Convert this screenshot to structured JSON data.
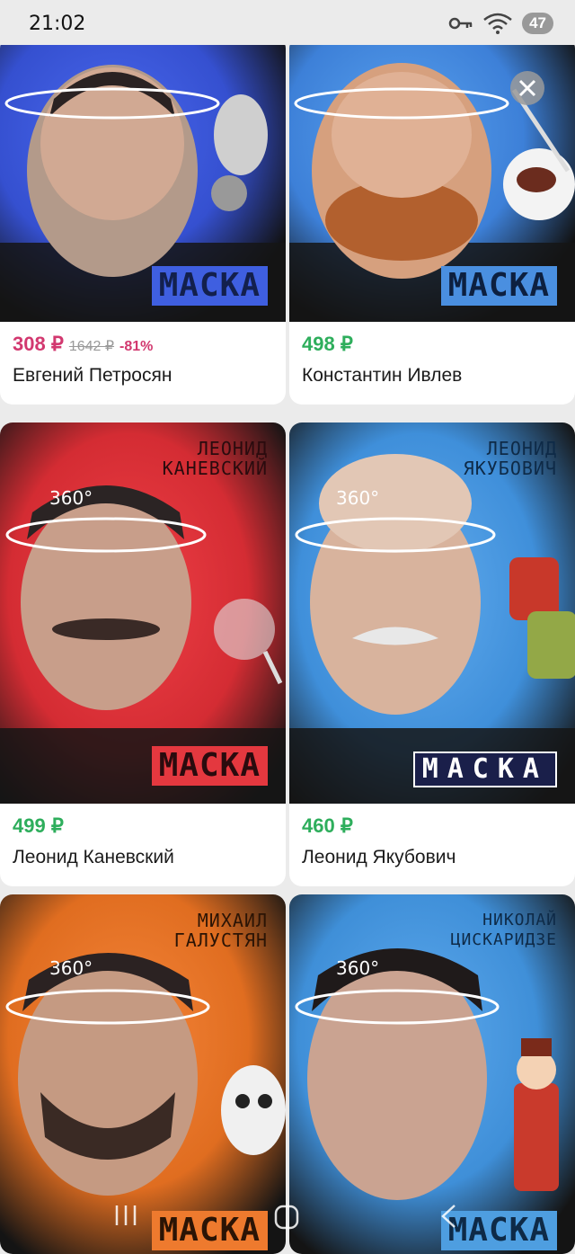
{
  "status_bar": {
    "time": "21:02",
    "battery": "47"
  },
  "products": [
    {
      "title": "Евгений Петросян",
      "price": "308 ₽",
      "old_price": "1642 ₽",
      "discount": "-81%",
      "brand": "МАСКА",
      "name_tag": "",
      "degrees": "",
      "bg": "#3f5fe0"
    },
    {
      "title": "Константин Ивлев",
      "price": "498 ₽",
      "old_price": "",
      "discount": "",
      "brand": "МАСКА",
      "name_tag": "",
      "degrees": "",
      "bg": "#4a8fe0"
    },
    {
      "title": "Леонид Каневский",
      "price": "499 ₽",
      "old_price": "",
      "discount": "",
      "brand": "МАСКА",
      "name_tag": "ЛЕОНИД\nКАНЕВСКИЙ",
      "degrees": "360°",
      "bg": "#e4383f"
    },
    {
      "title": "Леонид Якубович",
      "price": "460 ₽",
      "old_price": "",
      "discount": "",
      "brand": "МАСКА",
      "name_tag": "ЛЕОНИД\nЯКУБОВИЧ",
      "degrees": "360°",
      "bg": "#4d9fe6"
    },
    {
      "title": "",
      "price": "",
      "old_price": "",
      "discount": "",
      "brand": "МАСКА",
      "name_tag": "МИХАИЛ\nГАЛУСТЯН",
      "degrees": "360°",
      "bg": "#ee7a2e"
    },
    {
      "title": "",
      "price": "",
      "old_price": "",
      "discount": "",
      "brand": "МАСКА",
      "name_tag": "НИКОЛАЙ\nЦИСКАРИДЗЕ",
      "degrees": "360°",
      "bg": "#4e9ee0"
    }
  ],
  "colors": {
    "sale": "#d2386f",
    "price": "#2eae5c",
    "background": "#ebebeb"
  },
  "icons": [
    "key-icon",
    "wifi-icon",
    "recent-apps-icon",
    "home-icon",
    "back-icon",
    "close-icon"
  ]
}
